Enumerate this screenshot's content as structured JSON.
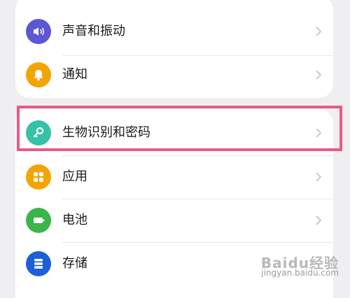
{
  "settings": {
    "items": [
      {
        "label": "声音和振动",
        "icon": "volume-icon",
        "color": "#5b57d6"
      },
      {
        "label": "通知",
        "icon": "bell-icon",
        "color": "#f2a500"
      },
      {
        "label": "生物识别和密码",
        "icon": "key-icon",
        "color": "#35c2a6"
      },
      {
        "label": "应用",
        "icon": "apps-grid-icon",
        "color": "#f2a500"
      },
      {
        "label": "电池",
        "icon": "battery-icon",
        "color": "#39b54a"
      },
      {
        "label": "存储",
        "icon": "storage-icon",
        "color": "#1e5fd8"
      }
    ]
  },
  "highlight_color": "#e85a86",
  "watermark": {
    "brand": "Baidu经验",
    "url": "jingyan.baidu.com"
  }
}
